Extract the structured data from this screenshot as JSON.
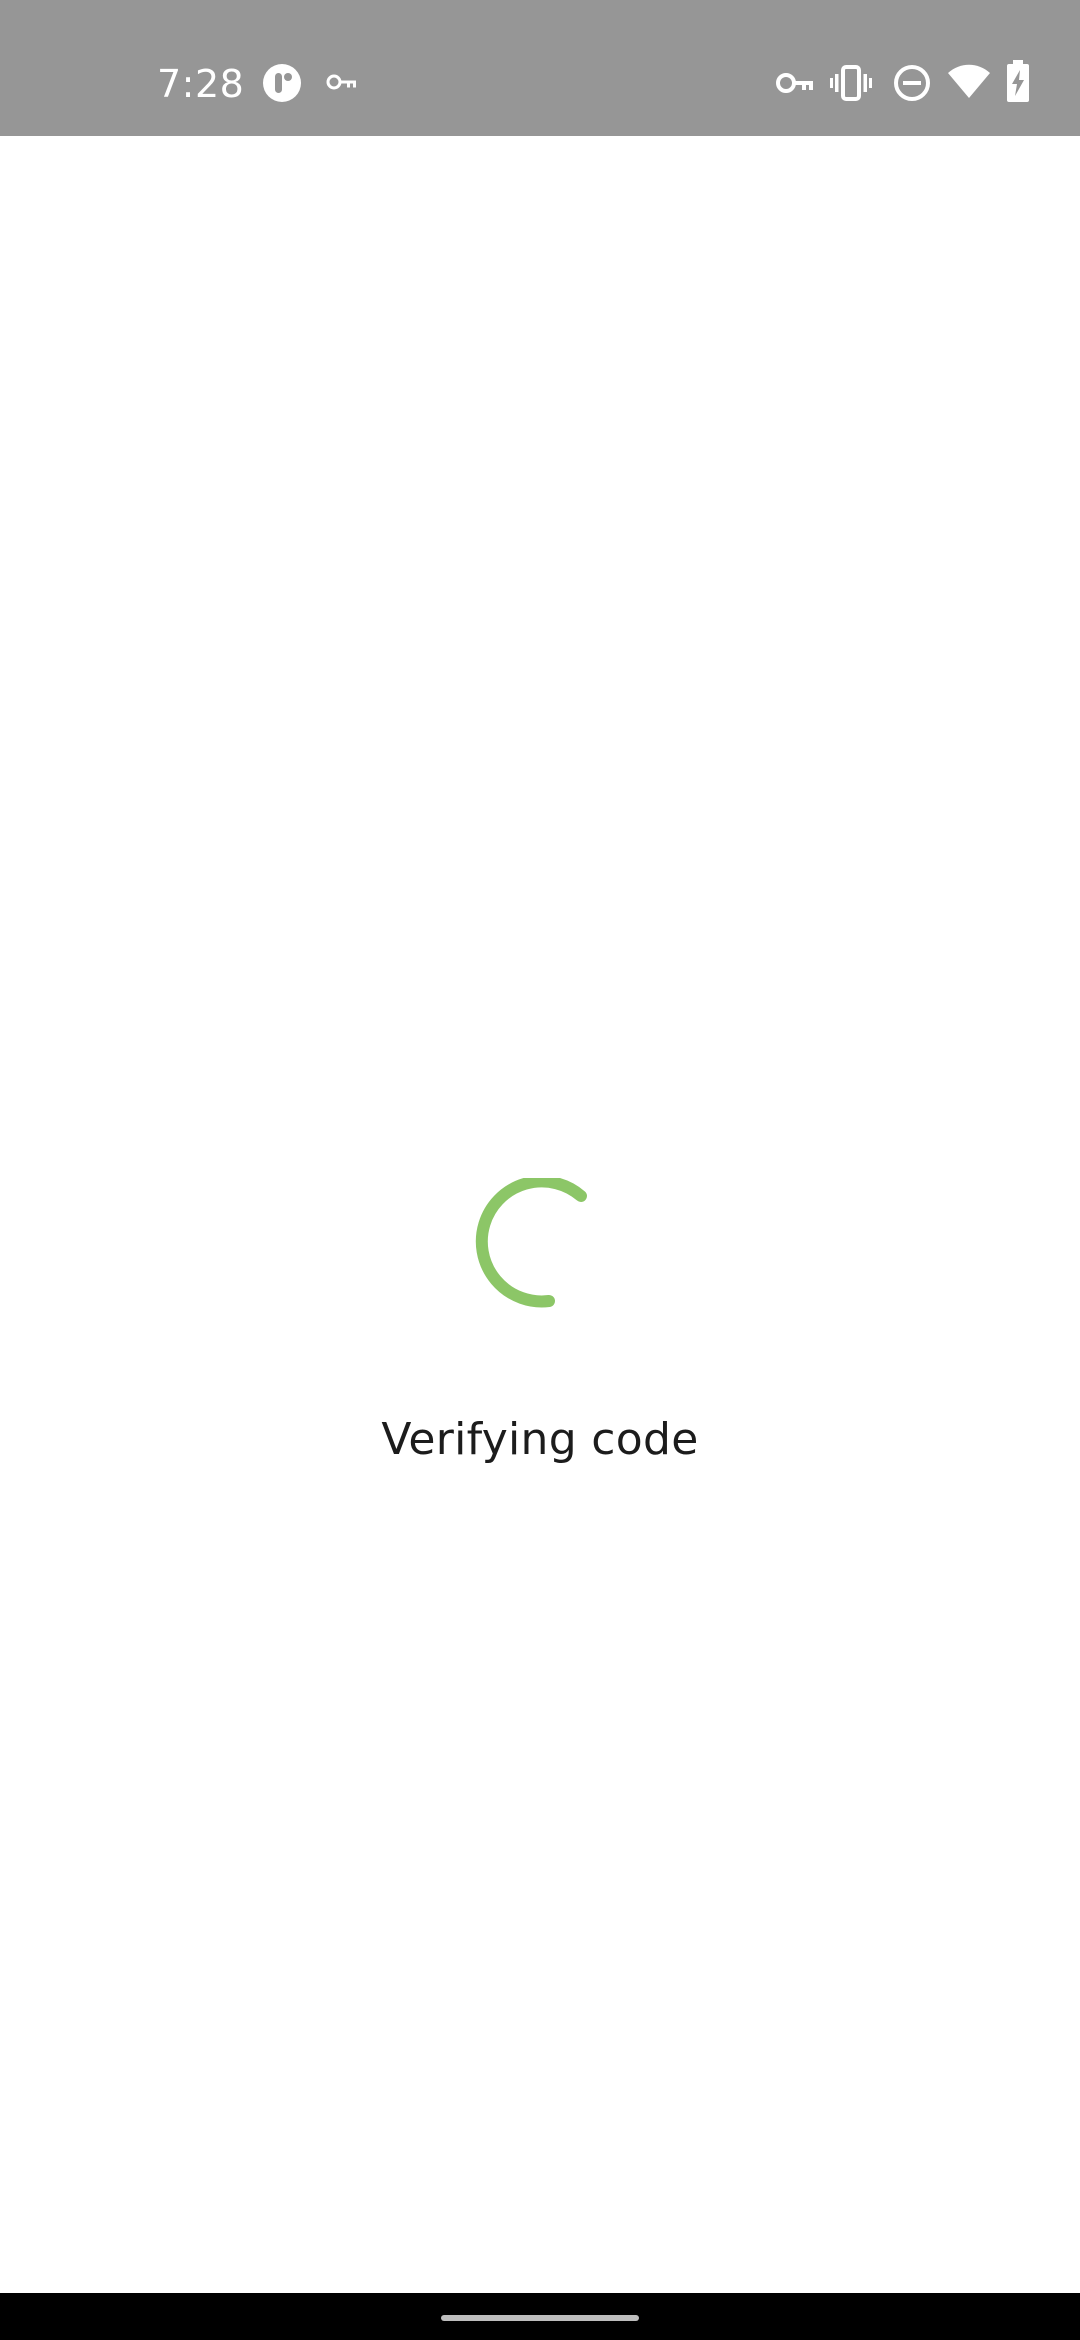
{
  "status_bar": {
    "time": "7:28",
    "left_icons": [
      "app-notification-icon",
      "vpn-key-icon"
    ],
    "right_icons": [
      "vpn-key-icon",
      "vibrate-icon",
      "do-not-disturb-icon",
      "wifi-icon",
      "battery-charging-icon"
    ]
  },
  "loading": {
    "message": "Verifying code",
    "spinner_color": "#8cc667"
  },
  "colors": {
    "status_bar_bg": "#969696",
    "background": "#ffffff",
    "text": "#1c1c1c",
    "nav_bar_bg": "#000000"
  }
}
